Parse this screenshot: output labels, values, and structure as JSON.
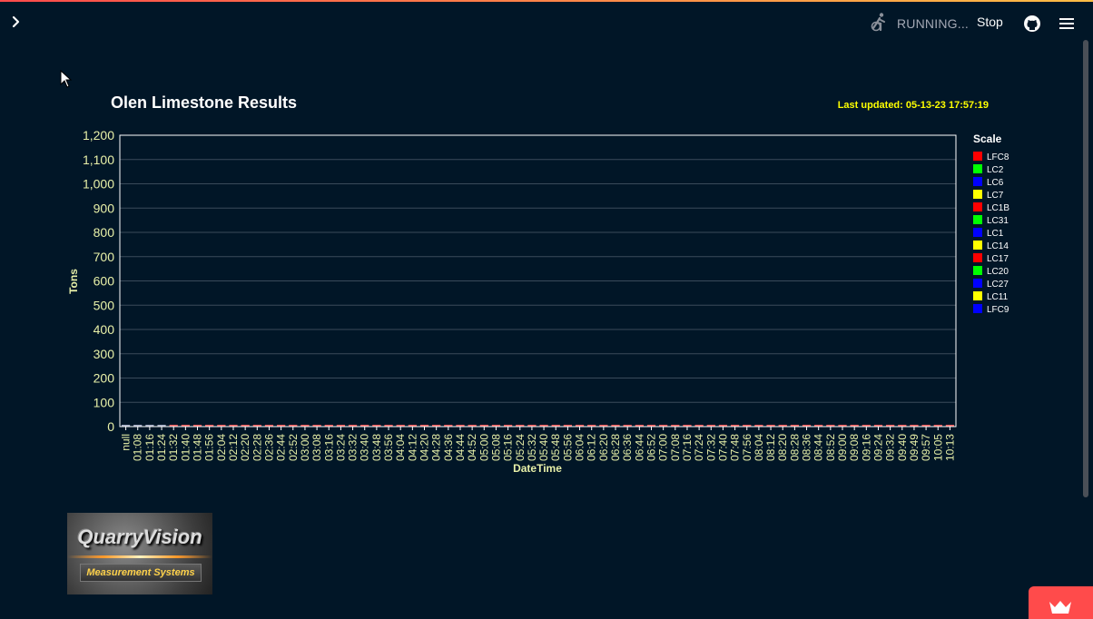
{
  "header": {
    "status_text": "RUNNING...",
    "stop_label": "Stop",
    "icons": {
      "sidebar": "chevron-right-icon",
      "status": "running-person-icon",
      "github": "github-icon",
      "menu": "hamburger-menu-icon"
    }
  },
  "colors": {
    "background": "#011627",
    "tick_text": "#e8f0a8",
    "updated_text": "#ffff00",
    "accent": "#ff4b4b"
  },
  "logo": {
    "main_text": "QuarryVision",
    "sub_text": "Measurement Systems"
  },
  "chart_data": {
    "type": "bar",
    "title": "Olen Limestone Results",
    "updated": "Last updated: 05-13-23 17:57:19",
    "xlabel": "DateTime",
    "ylabel": "Tons",
    "ylim": [
      0,
      1200
    ],
    "yticks": [
      "0",
      "100",
      "200",
      "300",
      "400",
      "500",
      "600",
      "700",
      "800",
      "900",
      "1,000",
      "1,100",
      "1,200"
    ],
    "xticks": [
      "null",
      "01:08",
      "01:16",
      "01:24",
      "01:32",
      "01:40",
      "01:48",
      "01:56",
      "02:04",
      "02:12",
      "02:20",
      "02:28",
      "02:36",
      "02:44",
      "02:52",
      "03:00",
      "03:08",
      "03:16",
      "03:24",
      "03:32",
      "03:40",
      "03:48",
      "03:56",
      "04:04",
      "04:12",
      "04:20",
      "04:28",
      "04:36",
      "04:44",
      "04:52",
      "05:00",
      "05:08",
      "05:16",
      "05:24",
      "05:32",
      "05:40",
      "05:48",
      "05:56",
      "06:04",
      "06:12",
      "06:20",
      "06:28",
      "06:36",
      "06:44",
      "06:52",
      "07:00",
      "07:08",
      "07:16",
      "07:24",
      "07:32",
      "07:40",
      "07:48",
      "07:56",
      "08:04",
      "08:12",
      "08:20",
      "08:28",
      "08:36",
      "08:44",
      "08:52",
      "09:00",
      "09:08",
      "09:16",
      "09:24",
      "09:32",
      "09:40",
      "09:49",
      "09:57",
      "10:05",
      "10:13"
    ],
    "grid": true,
    "legend_placement": "right",
    "legend_title": "Scale",
    "series": [
      {
        "name": "LFC8",
        "color": "#ff0000"
      },
      {
        "name": "LC2",
        "color": "#00ff00"
      },
      {
        "name": "LC6",
        "color": "#0000ff"
      },
      {
        "name": "LC7",
        "color": "#ffff00"
      },
      {
        "name": "LC1B",
        "color": "#ff0000"
      },
      {
        "name": "LC31",
        "color": "#00ff00"
      },
      {
        "name": "LC1",
        "color": "#0000ff"
      },
      {
        "name": "LC14",
        "color": "#ffff00"
      },
      {
        "name": "LC17",
        "color": "#ff0000"
      },
      {
        "name": "LC20",
        "color": "#00ff00"
      },
      {
        "name": "LC27",
        "color": "#0000ff"
      },
      {
        "name": "LC11",
        "color": "#ffff00"
      },
      {
        "name": "LFC9",
        "color": "#0000ff"
      }
    ],
    "values_note_free": true,
    "values": [
      0,
      0,
      0,
      0,
      0,
      0,
      0,
      0,
      0,
      0,
      0,
      0,
      0,
      0,
      0,
      0,
      0,
      0,
      0,
      0,
      0,
      0,
      0,
      0,
      0,
      0,
      0,
      0,
      0,
      0,
      0,
      0,
      0,
      0,
      0,
      0,
      0,
      0,
      0,
      0,
      0,
      0,
      0,
      0,
      0,
      0,
      0,
      0,
      0,
      0,
      0,
      0,
      0,
      0,
      0,
      0,
      0,
      0,
      0,
      0,
      0,
      0,
      0,
      0,
      0,
      0,
      0,
      0,
      0,
      0
    ]
  }
}
